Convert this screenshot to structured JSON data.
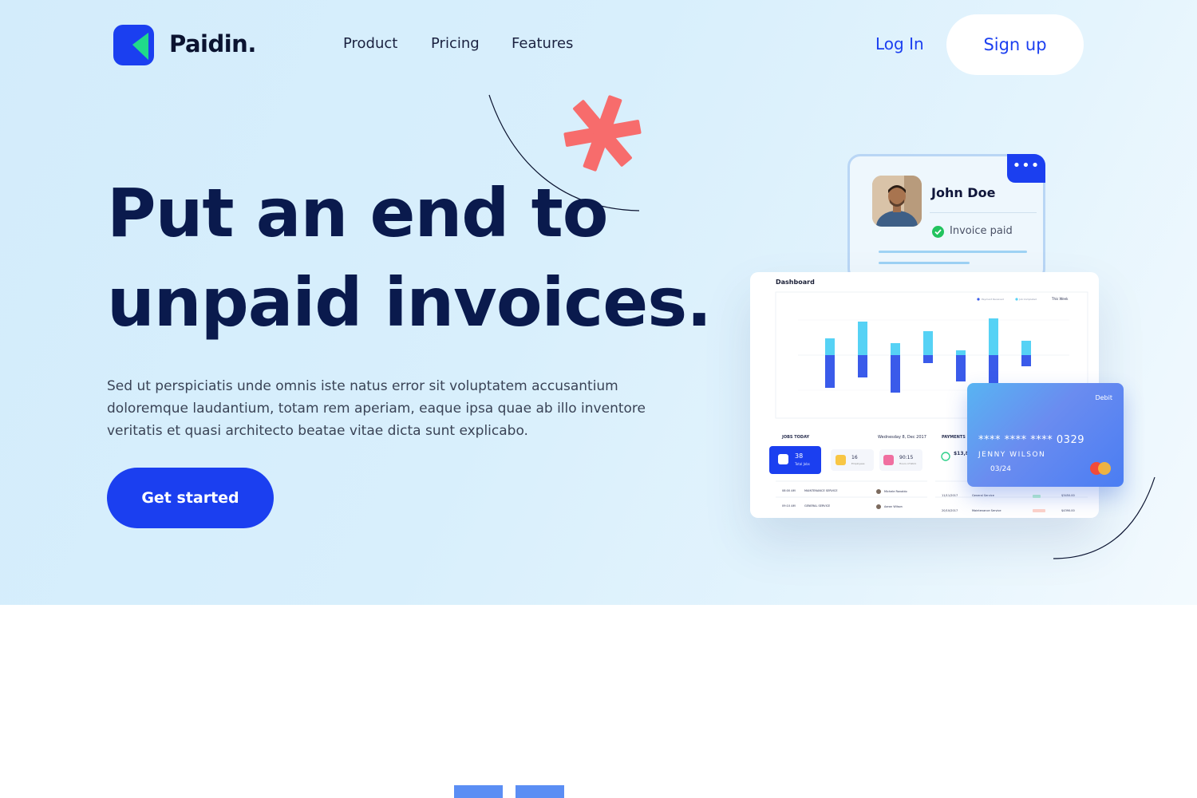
{
  "nav": {
    "brand": "Paidin.",
    "links": [
      "Product",
      "Pricing",
      "Features"
    ],
    "login": "Log In",
    "signup": "Sign up"
  },
  "hero": {
    "headline_line1": "Put an end to",
    "headline_line2": "unpaid invoices.",
    "lead": "Sed ut perspiciatis unde omnis iste natus error sit voluptatem accusantium doloremque laudantium, totam rem aperiam, eaque ipsa quae ab illo inventore veritatis et quasi architecto beatae vitae dicta sunt explicabo.",
    "cta": "Get started"
  },
  "profile_card": {
    "name": "John Doe",
    "status": "Invoice paid",
    "menu_icon": "more-dots-icon"
  },
  "dashboard": {
    "title": "Dashboard",
    "jobs_today": "JOBS TODAY",
    "date": "Wednesday 8, Dec 2017",
    "payments": "PAYMENTS",
    "stats": [
      {
        "value": "38",
        "label": "Total Jobs"
      },
      {
        "value": "16",
        "label": "Employees"
      },
      {
        "value": "90:15",
        "label": "Hours of Work"
      }
    ],
    "payment_amount": "$13,8",
    "rows": [
      {
        "time": "08:00 AM",
        "service": "MAINTENANCE SERVICE",
        "person": "Michele Ronaldo"
      },
      {
        "time": "09:10 AM",
        "service": "GENERAL SERVICE",
        "person": "Aaron Wilson"
      }
    ],
    "payment_rows": [
      {
        "date": "11/11/2017",
        "name": "General Service",
        "amount": "$3450.00"
      },
      {
        "date": "20/10/2017",
        "name": "Maintenance Service",
        "amount": "$4390.00"
      }
    ],
    "legend": [
      "Payment Received",
      "Job Completed"
    ],
    "period": "This Week",
    "accent_colors": {
      "top": "#56d2f5",
      "bottom": "#3a5bea"
    }
  },
  "debit_card": {
    "type": "Debit",
    "number": "**** **** **** 0329",
    "holder": "JENNY WILSON",
    "expiry": "03/24"
  },
  "colors": {
    "brand_blue": "#1b3ff0",
    "headline": "#0a1a4d",
    "accent_asterisk": "#f76c6c"
  }
}
